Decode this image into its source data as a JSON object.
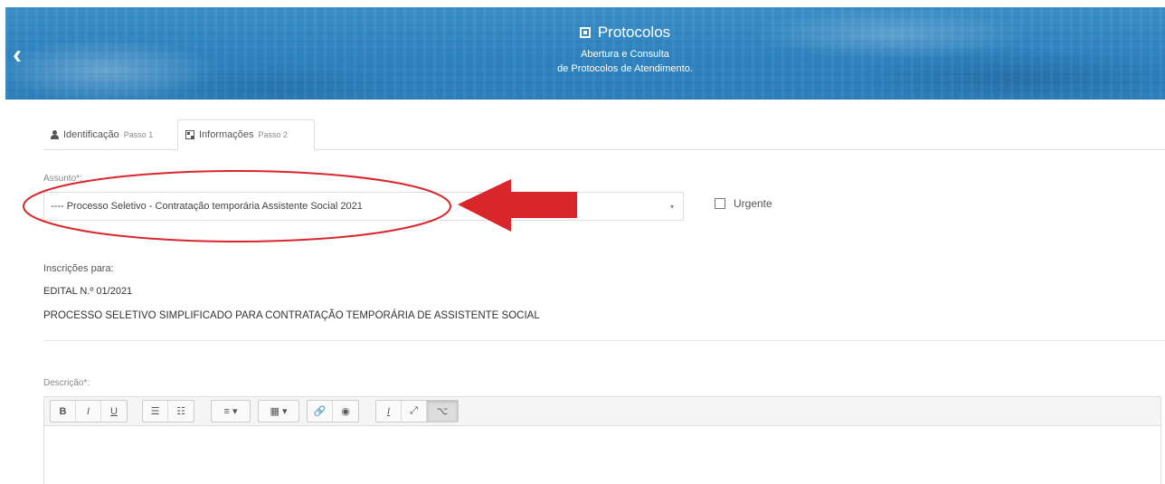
{
  "header": {
    "back_icon": "chevron-left-icon",
    "title_icon": "qrcode-icon",
    "title": "Protocolos",
    "subtitle_line1": "Abertura e Consulta",
    "subtitle_line2": "de Protocolos de Atendimento."
  },
  "tabs": [
    {
      "icon": "user-icon",
      "label": "Identificação",
      "step": "Passo 1"
    },
    {
      "icon": "qrcode-icon",
      "label": "Informações",
      "step": "Passo 2"
    }
  ],
  "assunto": {
    "label": "Assunto*:",
    "selected": "---- Processo Seletivo - Contratação temporária Assistente Social 2021",
    "caret": "▾"
  },
  "urgente": {
    "label": "Urgente",
    "checked": false
  },
  "inscricoes": {
    "label": "Inscrições para:",
    "edital": "EDITAL N.º 01/2021",
    "processo": "PROCESSO SELETIVO SIMPLIFICADO PARA CONTRATAÇÃO TEMPORÁRIA DE ASSISTENTE SOCIAL"
  },
  "descricao": {
    "label": "Descrição*:",
    "toolbar": {
      "bold": "B",
      "italic": "I",
      "underline": "U",
      "bullet_list": "☰",
      "ordered_list": "☷",
      "align": "≡ ▾",
      "table": "▦ ▾",
      "link": "🔗",
      "eye": "◉",
      "clear_format": "I",
      "fullscreen": "⤢",
      "code": "⌥"
    }
  },
  "colors": {
    "annotation_red": "#d8262b",
    "banner_blue": "#2f83bf"
  }
}
